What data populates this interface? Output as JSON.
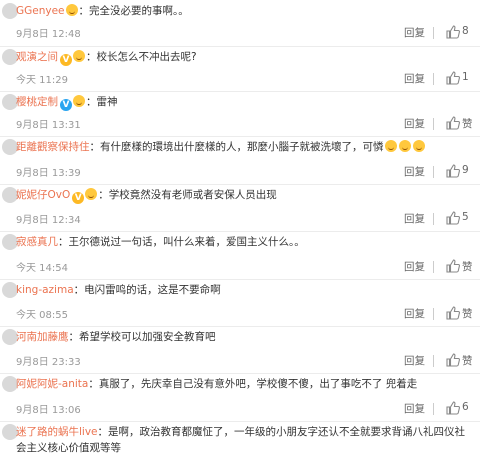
{
  "ui": {
    "reply_label": "回复",
    "zan_label": "赞"
  },
  "comments": [
    {
      "user": "GGenyee",
      "text": "：完全没必要的事啊。。",
      "time": "9月8日 12:48",
      "likes": "8"
    },
    {
      "user": "观演之间",
      "text": "：校长怎么不冲出去呢?",
      "time": "今天 11:29",
      "likes": "1"
    },
    {
      "user": "樱桃定制",
      "text": "：雷神",
      "time": "9月8日 13:31",
      "likes": "赞"
    },
    {
      "user": "距離觀察保持住",
      "text": "：有什麼樣的環境出什麼樣的人，那麼小腦子就被洗壞了，可憐",
      "time": "9月8日 13:39",
      "likes": "9"
    },
    {
      "user": "妮妮仔OvO",
      "text": "：学校竟然没有老师或者安保人员出现",
      "time": "9月8日 12:34",
      "likes": "5"
    },
    {
      "user": "寂感真几",
      "text": "：王尔德说过一句话，叫什么来着，爱国主义什么。。",
      "time": "今天 14:54",
      "likes": "赞"
    },
    {
      "user": "king-azima",
      "text": "：电闪雷鸣的话，这是不要命啊",
      "time": "今天 08:55",
      "likes": "赞"
    },
    {
      "user": "河南加藤鹰",
      "text": "：希望学校可以加强安全教育吧",
      "time": "9月8日 23:33",
      "likes": "赞"
    },
    {
      "user": "阿妮阿妮-anita",
      "text": "：真服了，先庆幸自己没有意外吧，学校傻不傻，出了事吃不了 兜着走",
      "time": "9月8日 13:06",
      "likes": "6"
    },
    {
      "user": "迷了路的蜗牛live",
      "text": "：是啊，政治教育都魔怔了，一年级的小朋友字还认不全就要求背诵八礼四仪社",
      "text2": "会主义核心价值观等等"
    }
  ]
}
